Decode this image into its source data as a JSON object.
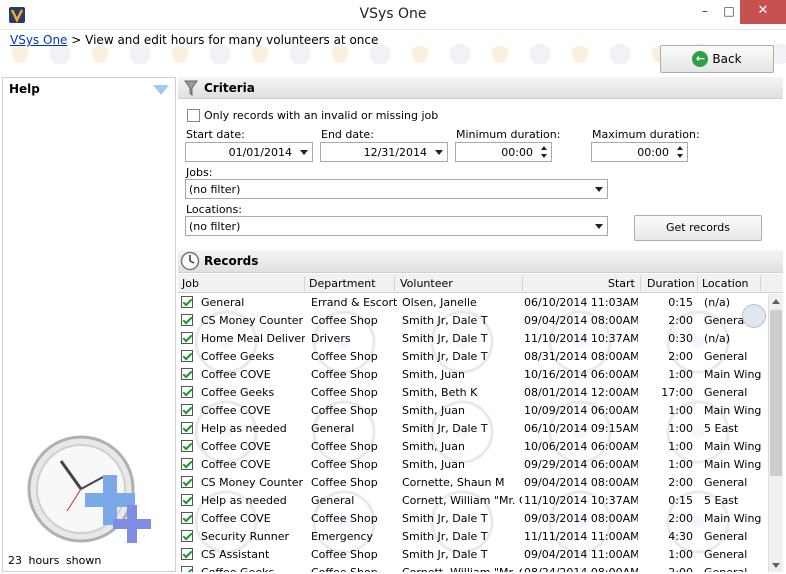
{
  "window": {
    "title": "VSys One",
    "minimize": "–",
    "maximize": "□",
    "close": "✕"
  },
  "breadcrumb": {
    "link": "VSys One",
    "separator": ">",
    "text": "View and edit hours for many volunteers at once"
  },
  "back_button": {
    "label": "Back",
    "icon": "back-arrow-icon"
  },
  "help": {
    "title": "Help",
    "hours_shown": "23 hours shown"
  },
  "criteria": {
    "title": "Criteria",
    "invalid_job_label": "Only records with an invalid or missing job",
    "start_date_label": "Start date:",
    "start_date": "01/01/2014",
    "end_date_label": "End date:",
    "end_date": "12/31/2014",
    "min_duration_label": "Minimum duration:",
    "min_duration": "00:00",
    "max_duration_label": "Maximum duration:",
    "max_duration": "00:00",
    "jobs_label": "Jobs:",
    "jobs_value": "(no filter)",
    "locations_label": "Locations:",
    "locations_value": "(no filter)",
    "get_records": "Get records"
  },
  "records": {
    "title": "Records",
    "columns": [
      "Job",
      "Department",
      "Volunteer",
      "Start",
      "Duration",
      "Location"
    ],
    "rows": [
      [
        "General",
        "Errand & Escort",
        "Olsen, Janelle",
        "06/10/2014 11:03AM",
        "0:15",
        "(n/a)"
      ],
      [
        "CS Money Counter",
        "Coffee Shop",
        "Smith Jr, Dale T",
        "09/04/2014 08:00AM",
        "2:00",
        "General"
      ],
      [
        "Home Meal Delivery",
        "Drivers",
        "Smith Jr, Dale T",
        "11/10/2014 10:37AM",
        "0:30",
        "(n/a)"
      ],
      [
        "Coffee Geeks",
        "Coffee Shop",
        "Smith Jr, Dale T",
        "08/31/2014 08:00AM",
        "2:00",
        "General"
      ],
      [
        "Coffee COVE",
        "Coffee Shop",
        "Smith, Juan",
        "10/16/2014 06:00AM",
        "1:00",
        "Main Wing"
      ],
      [
        "Coffee Geeks",
        "Coffee Shop",
        "Smith, Beth K",
        "08/01/2014 12:00AM",
        "17:00",
        "General"
      ],
      [
        "Coffee COVE",
        "Coffee Shop",
        "Smith, Juan",
        "10/09/2014 06:00AM",
        "1:00",
        "Main Wing"
      ],
      [
        "Help as needed",
        "General",
        "Smith Jr, Dale T",
        "06/10/2014 09:15AM",
        "1:00",
        "5 East"
      ],
      [
        "Coffee COVE",
        "Coffee Shop",
        "Smith, Juan",
        "10/06/2014 06:00AM",
        "1:00",
        "Main Wing"
      ],
      [
        "Coffee COVE",
        "Coffee Shop",
        "Smith, Juan",
        "09/29/2014 06:00AM",
        "1:00",
        "Main Wing"
      ],
      [
        "CS Money Counter",
        "Coffee Shop",
        "Cornette, Shaun M",
        "09/04/2014 08:00AM",
        "2:00",
        "General"
      ],
      [
        "Help as needed",
        "General",
        "Cornett, William \"Mr. C\"",
        "11/10/2014 10:37AM",
        "0:15",
        "5 East"
      ],
      [
        "Coffee COVE",
        "Coffee Shop",
        "Smith Jr, Dale T",
        "09/03/2014 08:00AM",
        "2:00",
        "Main Wing"
      ],
      [
        "Security Runner",
        "Emergency",
        "Smith Jr, Dale T",
        "11/11/2014 11:00AM",
        "4:30",
        "General"
      ],
      [
        "CS Assistant",
        "Coffee Shop",
        "Smith Jr, Dale T",
        "09/04/2014 11:00AM",
        "1:00",
        "General"
      ],
      [
        "Coffee Geeks",
        "Coffee Shop",
        "Cornett, William \"Mr. C\"",
        "08/24/2014 08:00AM",
        "2:00",
        "General"
      ]
    ]
  }
}
